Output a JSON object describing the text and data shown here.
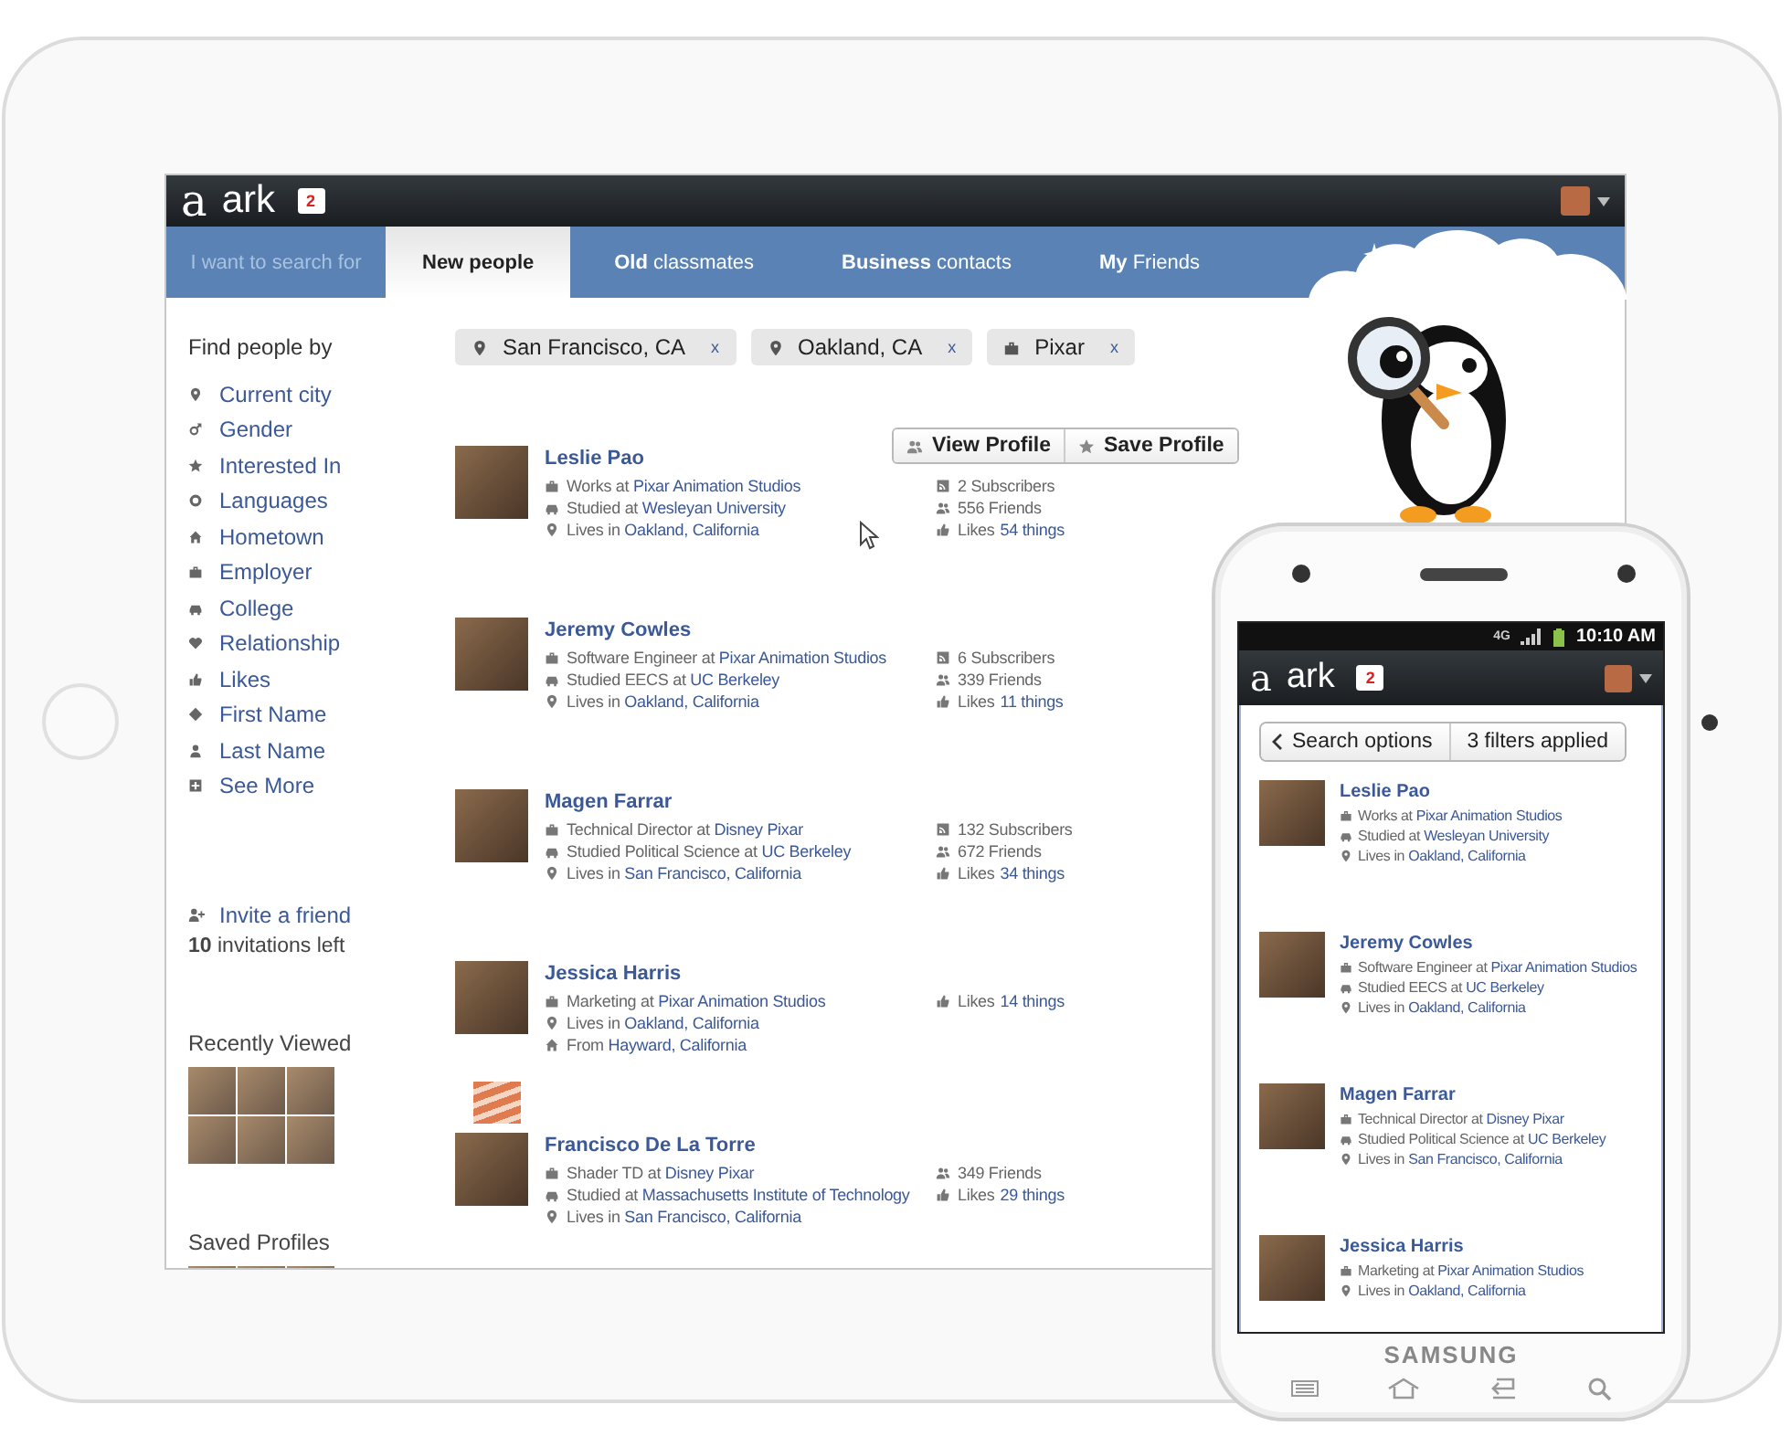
{
  "tablet": {
    "logo_mark": "a",
    "logo_text": "ark",
    "notifications": "2",
    "search_label": "I want to search for",
    "tabs": [
      {
        "label": "New people",
        "selected": true
      },
      {
        "label": "**Old** classmates",
        "selected": false
      },
      {
        "label": "**Business** contacts",
        "selected": false
      },
      {
        "label": "**My** Friends",
        "selected": false
      }
    ],
    "sidebar": {
      "heading": "Find people by",
      "items": [
        {
          "kind": "city",
          "label": "Current city"
        },
        {
          "kind": "gender",
          "label": "Gender"
        },
        {
          "kind": "interest",
          "label": "Interested In"
        },
        {
          "kind": "language",
          "label": "Languages"
        },
        {
          "kind": "hometown",
          "label": "Hometown"
        },
        {
          "kind": "employer",
          "label": "Employer"
        },
        {
          "kind": "college",
          "label": "College"
        },
        {
          "kind": "relationship",
          "label": "Relationship"
        },
        {
          "kind": "likes",
          "label": "Likes"
        },
        {
          "kind": "first-name",
          "label": "First Name"
        },
        {
          "kind": "last-name",
          "label": "Last Name"
        },
        {
          "kind": "more",
          "label": "See More"
        }
      ],
      "invite": "Invite a friend",
      "invitations_left": "**10** invitations left",
      "recently_viewed": "Recently Viewed",
      "saved_profiles": "Saved Profiles"
    },
    "filters": [
      {
        "kind": "location",
        "label": "San Francisco, CA",
        "remove": "x"
      },
      {
        "kind": "location",
        "label": "Oakland, CA",
        "remove": "x"
      },
      {
        "kind": "company",
        "label": "Pixar",
        "remove": "x"
      }
    ],
    "results": [
      {
        "name": "Leslie Pao",
        "lines": [
          {
            "kind": "work",
            "text": "Works at",
            "link": "Pixar Animation Studios"
          },
          {
            "kind": "school",
            "text": "Studied at",
            "link": "Wesleyan University"
          },
          {
            "kind": "lives",
            "text": "Lives in",
            "link": "Oakland, California"
          }
        ],
        "stats": [
          {
            "kind": "subscribers",
            "text": "2 Subscribers"
          },
          {
            "kind": "friends",
            "text": "556 Friends"
          },
          {
            "kind": "likes",
            "text": "Likes",
            "link": "54 things"
          }
        ],
        "actions": [
          {
            "kind": "view",
            "label": "View Profile"
          },
          {
            "kind": "save",
            "label": "Save Profile"
          }
        ]
      },
      {
        "name": "Jeremy Cowles",
        "lines": [
          {
            "kind": "work",
            "text": "Software Engineer at",
            "link": "Pixar Animation Studios"
          },
          {
            "kind": "school",
            "text": "Studied EECS at",
            "link": "UC Berkeley"
          },
          {
            "kind": "lives",
            "text": "Lives in",
            "link": "Oakland, California"
          }
        ],
        "stats": [
          {
            "kind": "subscribers",
            "text": "6 Subscribers"
          },
          {
            "kind": "friends",
            "text": "339 Friends"
          },
          {
            "kind": "likes",
            "text": "Likes",
            "link": "11 things"
          }
        ]
      },
      {
        "name": "Magen Farrar",
        "lines": [
          {
            "kind": "work",
            "text": "Technical Director at",
            "link": "Disney Pixar"
          },
          {
            "kind": "school",
            "text": "Studied Political Science at",
            "link": "UC Berkeley"
          },
          {
            "kind": "lives",
            "text": "Lives in",
            "link": "San Francisco, California"
          }
        ],
        "stats": [
          {
            "kind": "subscribers",
            "text": "132 Subscribers"
          },
          {
            "kind": "friends",
            "text": "672 Friends"
          },
          {
            "kind": "likes",
            "text": "Likes",
            "link": "34 things"
          }
        ]
      },
      {
        "name": "Jessica Harris",
        "lines": [
          {
            "kind": "work",
            "text": "Marketing at",
            "link": "Pixar Animation Studios"
          },
          {
            "kind": "lives",
            "text": "Lives in",
            "link": "Oakland, California"
          },
          {
            "kind": "from",
            "text": "From",
            "link": "Hayward, California"
          }
        ],
        "stats": [
          {
            "kind": "likes",
            "text": "Likes",
            "link": "14 things"
          }
        ],
        "attachment": true
      },
      {
        "name": "Francisco De La Torre",
        "lines": [
          {
            "kind": "work",
            "text": "Shader TD at",
            "link": "Disney Pixar"
          },
          {
            "kind": "school",
            "text": "Studied at",
            "link": "Massachusetts Institute of Technology"
          },
          {
            "kind": "lives",
            "text": "Lives in",
            "link": "San Francisco, California"
          }
        ],
        "stats": [
          {
            "kind": "friends",
            "text": "349 Friends"
          },
          {
            "kind": "likes",
            "text": "Likes",
            "link": "29 things"
          }
        ]
      }
    ]
  },
  "phone": {
    "network": "4G",
    "time": "10:10 AM",
    "logo_mark": "a",
    "logo_text": "ark",
    "notifications": "2",
    "search_options": "Search options",
    "filters_applied": "3 filters applied",
    "results": [
      {
        "name": "Leslie Pao",
        "lines": [
          {
            "kind": "work",
            "text": "Works at",
            "link": "Pixar Animation Studios"
          },
          {
            "kind": "school",
            "text": "Studied at",
            "link": "Wesleyan University"
          },
          {
            "kind": "lives",
            "text": "Lives in",
            "link": "Oakland, California"
          }
        ]
      },
      {
        "name": "Jeremy Cowles",
        "lines": [
          {
            "kind": "work",
            "text": "Software Engineer at",
            "link": "Pixar Animation Studios"
          },
          {
            "kind": "school",
            "text": "Studied EECS at",
            "link": "UC Berkeley"
          },
          {
            "kind": "lives",
            "text": "Lives in",
            "link": "Oakland, California"
          }
        ]
      },
      {
        "name": "Magen Farrar",
        "lines": [
          {
            "kind": "work",
            "text": "Technical Director at",
            "link": "Disney Pixar"
          },
          {
            "kind": "school",
            "text": "Studied Political Science at",
            "link": "UC Berkeley"
          },
          {
            "kind": "lives",
            "text": "Lives in",
            "link": "San Francisco, California"
          }
        ]
      },
      {
        "name": "Jessica Harris",
        "lines": [
          {
            "kind": "work",
            "text": "Marketing at",
            "link": "Pixar Animation Studios"
          },
          {
            "kind": "lives",
            "text": "Lives in",
            "link": "Oakland, California"
          }
        ]
      }
    ],
    "brand": "SAMSUNG"
  }
}
